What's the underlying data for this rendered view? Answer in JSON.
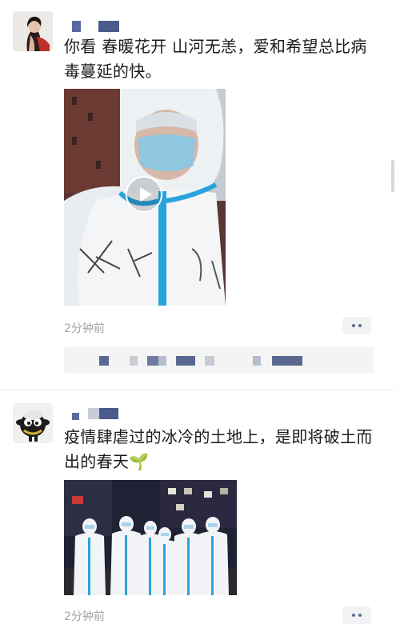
{
  "posts": [
    {
      "text": "你看 春暖花开 山河无恙，爱和希望总比病毒蔓延的快。",
      "time": "2分钟前",
      "media": {
        "type": "video",
        "icon": "play-icon"
      }
    },
    {
      "text": "疫情肆虐过的冰冷的土地上，是即将破土而出的春天🌱",
      "time": "2分钟前",
      "media": {
        "type": "photo"
      }
    }
  ],
  "colors": {
    "name_blue": "#4a5a8c",
    "time_gray": "#a4a4a4",
    "protective_suit_blue": "#2aa2de"
  }
}
